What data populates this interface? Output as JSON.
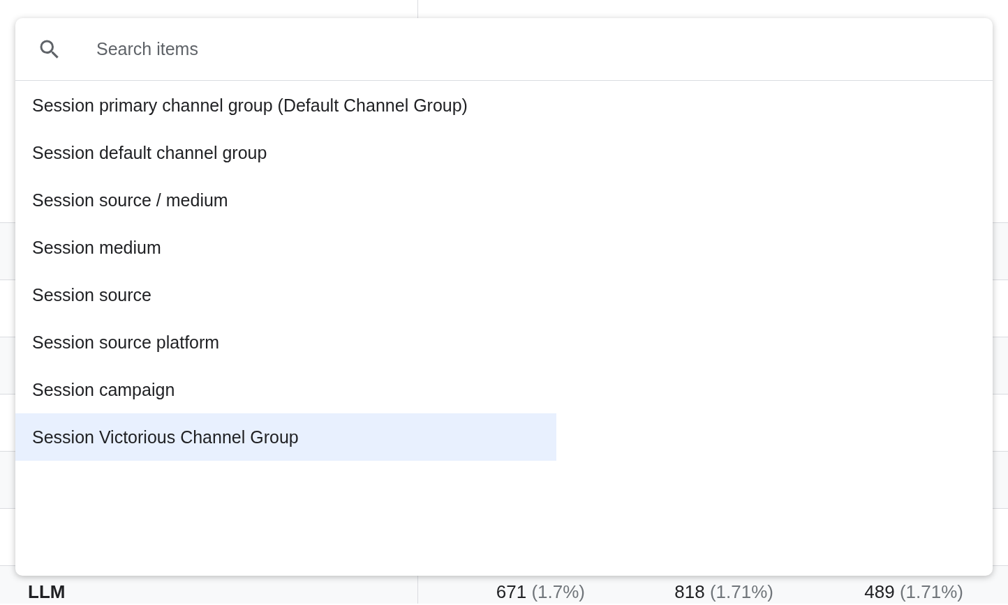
{
  "search": {
    "placeholder": "Search items"
  },
  "items": [
    {
      "label": "Session primary channel group (Default Channel Group)",
      "selected": false
    },
    {
      "label": "Session default channel group",
      "selected": false
    },
    {
      "label": "Session source / medium",
      "selected": false
    },
    {
      "label": "Session medium",
      "selected": false
    },
    {
      "label": "Session source",
      "selected": false
    },
    {
      "label": "Session source platform",
      "selected": false
    },
    {
      "label": "Session campaign",
      "selected": false
    },
    {
      "label": "Session Victorious Channel Group",
      "selected": true
    }
  ],
  "table": {
    "rows": [
      {
        "label": "LLM",
        "cells": [
          {
            "value": "671",
            "share": "(1.7%)"
          },
          {
            "value": "818",
            "share": "(1.71%)"
          },
          {
            "value": "489",
            "share": "(1.71%)"
          }
        ]
      }
    ]
  }
}
